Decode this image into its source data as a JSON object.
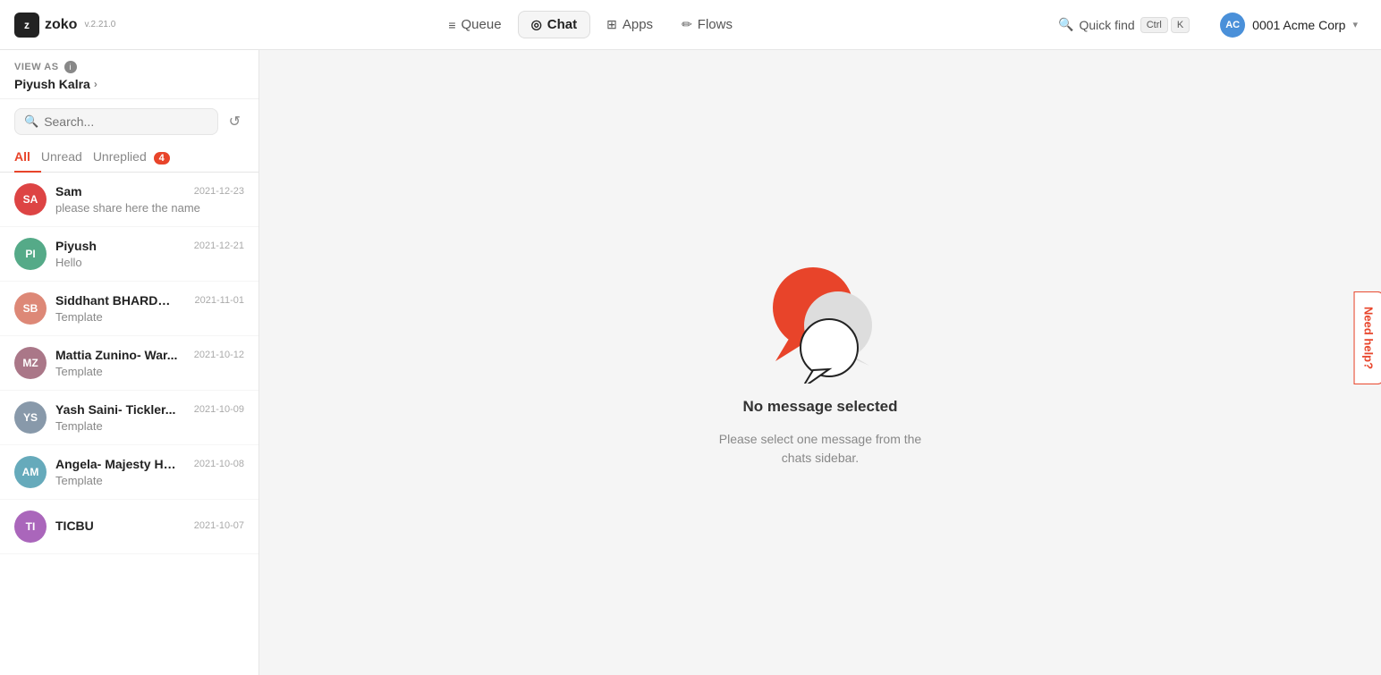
{
  "app": {
    "logo_text": "z",
    "logo_name": "zoko",
    "version": "v.2.21.0"
  },
  "nav": {
    "items": [
      {
        "id": "queue",
        "label": "Queue",
        "icon": "≡",
        "active": false
      },
      {
        "id": "chat",
        "label": "Chat",
        "icon": "◎",
        "active": true
      },
      {
        "id": "apps",
        "label": "Apps",
        "icon": "⊞",
        "active": false
      },
      {
        "id": "flows",
        "label": "Flows",
        "icon": "✏",
        "active": false
      }
    ],
    "quick_find": "Quick find",
    "kbd_ctrl": "Ctrl",
    "kbd_k": "K",
    "account_name": "0001 Acme Corp",
    "account_chevron": "▾"
  },
  "sidebar": {
    "view_as_label": "VIEW AS",
    "user_name": "Piyush Kalra",
    "search_placeholder": "Search...",
    "tabs": [
      {
        "id": "all",
        "label": "All",
        "active": true,
        "badge": null
      },
      {
        "id": "unread",
        "label": "Unread",
        "active": false,
        "badge": null
      },
      {
        "id": "unreplied",
        "label": "Unreplied",
        "active": false,
        "badge": "4"
      }
    ],
    "chats": [
      {
        "id": "sam",
        "initials": "SA",
        "name": "Sam",
        "date": "2021-12-23",
        "preview": "please share here the name",
        "avatar_color": "#d44"
      },
      {
        "id": "piyush",
        "initials": "PI",
        "name": "Piyush",
        "date": "2021-12-21",
        "preview": "Hello",
        "avatar_color": "#5a8"
      },
      {
        "id": "siddhant",
        "initials": "SB",
        "name": "Siddhant BHARDWA...",
        "date": "2021-11-01",
        "preview": "Template",
        "avatar_color": "#d87"
      },
      {
        "id": "mattia",
        "initials": "MZ",
        "name": "Mattia Zunino- War...",
        "date": "2021-10-12",
        "preview": "Template",
        "avatar_color": "#a78"
      },
      {
        "id": "yash",
        "initials": "YS",
        "name": "Yash Saini- Tickler...",
        "date": "2021-10-09",
        "preview": "Template",
        "avatar_color": "#89a"
      },
      {
        "id": "angela",
        "initials": "AM",
        "name": "Angela- Majesty Ha...",
        "date": "2021-10-08",
        "preview": "Template",
        "avatar_color": "#6ab"
      },
      {
        "id": "ticbu",
        "initials": "TI",
        "name": "TICBU",
        "date": "2021-10-07",
        "preview": "",
        "avatar_color": "#a6b"
      }
    ]
  },
  "main": {
    "no_message_title": "No message selected",
    "no_message_subtitle": "Please select one message from the\nchats sidebar."
  },
  "help": {
    "label": "Need help?"
  }
}
